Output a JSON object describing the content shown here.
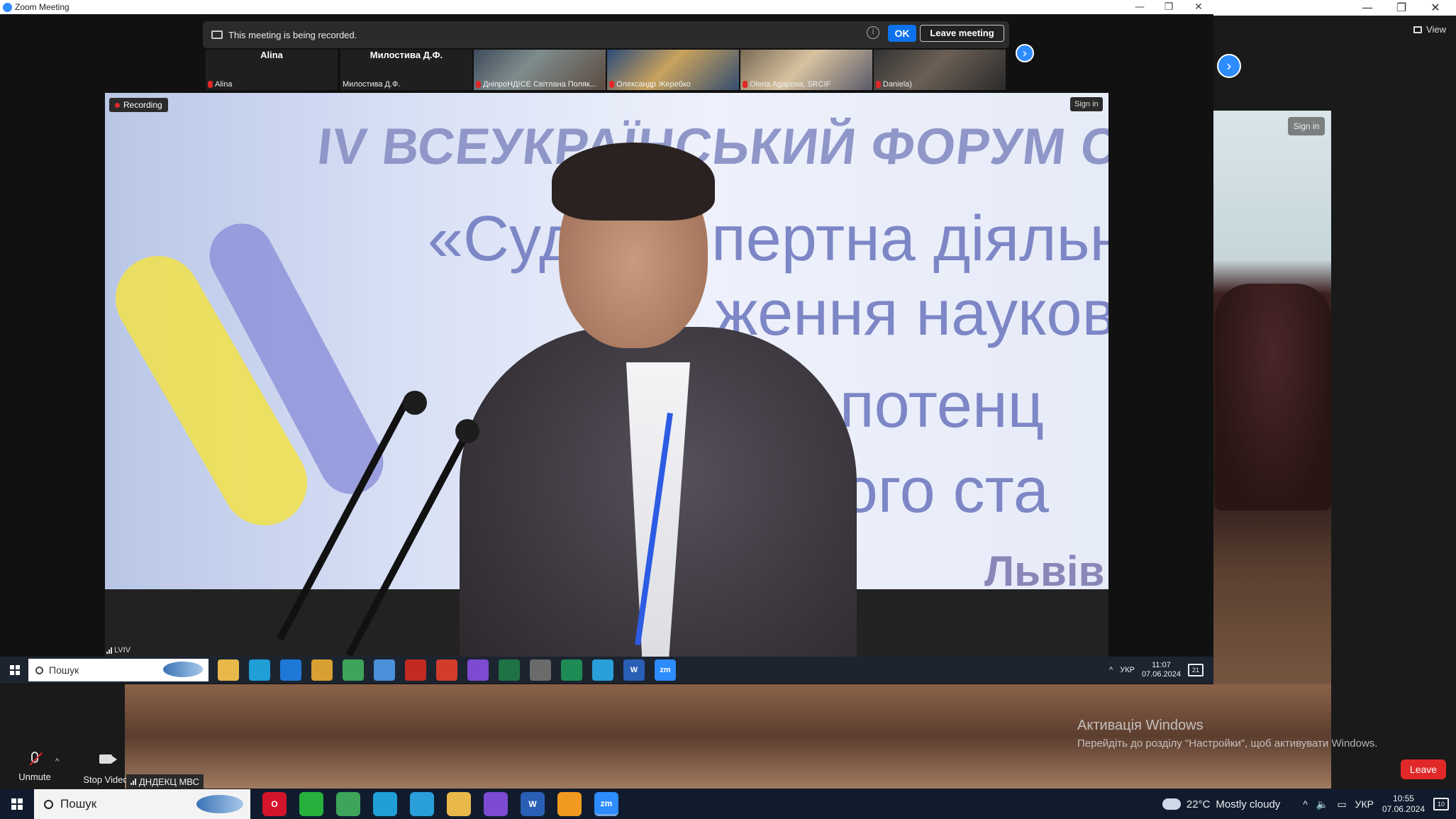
{
  "outer_window": {
    "view_label": "View",
    "controls": [
      "—",
      "❐",
      "✕"
    ]
  },
  "inner_window": {
    "title": "Zoom Meeting",
    "controls": [
      "—",
      "❐",
      "✕"
    ]
  },
  "recording_banner": {
    "message": "This meeting is being recorded.",
    "info_icon": "i",
    "ok_label": "OK",
    "leave_meeting_label": "Leave meeting"
  },
  "participants": [
    {
      "big_name": "Alina",
      "label": "Alina",
      "type": "name"
    },
    {
      "big_name": "Милостива Д.Ф.",
      "label": "Милостива Д.Ф.",
      "type": "name"
    },
    {
      "big_name": "",
      "label": "ДніпроНДІСЕ Світлана Поляк...",
      "type": "video"
    },
    {
      "big_name": "",
      "label": "Олександр Жеребко",
      "type": "video"
    },
    {
      "big_name": "",
      "label": "Olena Agapova, SRCIF",
      "type": "video"
    },
    {
      "big_name": "",
      "label": "Daniela)",
      "type": "video"
    }
  ],
  "arrows": {
    "next": "›"
  },
  "main_video": {
    "recording_label": "Recording",
    "sign_in_label": "Sign in",
    "location_label": "LVIV",
    "banner_title": "IV ВСЕУКРАЇНСЬКИЙ ФОРУМ СУДОВИХ ЕКСП",
    "banner_line1": "«Судо",
    "banner_line1b": "пертна діяльні",
    "banner_line2": "ження науков",
    "banner_line3": "го потенц",
    "banner_line4": "ного ста",
    "banner_city": "Львів -"
  },
  "inner_taskbar": {
    "search_placeholder": "Пошук",
    "icons": [
      {
        "name": "file-explorer-icon",
        "color": "#e8b84a",
        "glyph": ""
      },
      {
        "name": "edge-icon",
        "color": "#1f9fd6",
        "glyph": ""
      },
      {
        "name": "mail-icon",
        "color": "#1e78d6",
        "glyph": ""
      },
      {
        "name": "chrome-icon",
        "color": "#d8a032",
        "glyph": ""
      },
      {
        "name": "chrome-icon",
        "color": "#3ea45a",
        "glyph": ""
      },
      {
        "name": "store-icon",
        "color": "#4a90d9",
        "glyph": ""
      },
      {
        "name": "acrobat-icon",
        "color": "#c22a22",
        "glyph": ""
      },
      {
        "name": "app-red-icon",
        "color": "#d23c2c",
        "glyph": ""
      },
      {
        "name": "viber-icon",
        "color": "#7c4bd1",
        "glyph": ""
      },
      {
        "name": "excel-icon",
        "color": "#1f7244",
        "glyph": ""
      },
      {
        "name": "settings-app-icon",
        "color": "#6b6b6b",
        "glyph": ""
      },
      {
        "name": "sheets-icon",
        "color": "#1e8a54",
        "glyph": ""
      },
      {
        "name": "telegram-icon",
        "color": "#2a9ed8",
        "glyph": ""
      },
      {
        "name": "word-icon",
        "color": "#2a5fb6",
        "glyph": "W"
      },
      {
        "name": "zoom-icon",
        "color": "#2d8cff",
        "glyph": "zm"
      }
    ],
    "tray_lang": "УКР",
    "time": "11:07",
    "date": "07.06.2024",
    "notif_count": "21"
  },
  "side_panel": {
    "sign_in_label": "Sign in"
  },
  "activation": {
    "title": "Активація Windows",
    "subtitle": "Перейдіть до розділу \"Настройки\", щоб активувати Windows."
  },
  "controls": {
    "unmute_label": "Unmute",
    "stop_video_label": "Stop Video",
    "caret": "^",
    "leave_label": "Leave",
    "device_label": "ДНДЕКЦ МВС"
  },
  "outer_taskbar": {
    "search_placeholder": "Пошук",
    "icons": [
      {
        "name": "opera-icon",
        "color": "#d4142a",
        "glyph": "O"
      },
      {
        "name": "whatsapp-icon",
        "color": "#25b13c",
        "glyph": ""
      },
      {
        "name": "chrome-icon",
        "color": "#3ea45a",
        "glyph": ""
      },
      {
        "name": "edge-icon",
        "color": "#1f9fd6",
        "glyph": ""
      },
      {
        "name": "telegram-icon",
        "color": "#2a9ed8",
        "glyph": ""
      },
      {
        "name": "file-explorer-icon",
        "color": "#e8b84a",
        "glyph": ""
      },
      {
        "name": "viber-icon",
        "color": "#7c4bd1",
        "glyph": ""
      },
      {
        "name": "word-icon",
        "color": "#2a5fb6",
        "glyph": "W"
      },
      {
        "name": "app-orange-icon",
        "color": "#f29a1f",
        "glyph": ""
      },
      {
        "name": "zoom-icon",
        "color": "#2d8cff",
        "glyph": "zm"
      }
    ],
    "weather_temp": "22°C",
    "weather_text": "Mostly cloudy",
    "tray_lang": "УКР",
    "time": "10:55",
    "date": "07.06.2024",
    "notif_count": "10"
  }
}
